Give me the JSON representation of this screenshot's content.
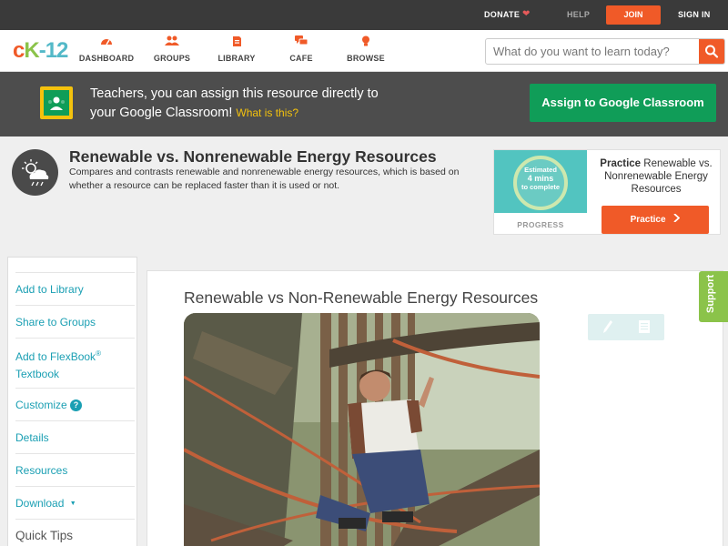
{
  "topbar": {
    "donate": "DONATE",
    "help": "HELP",
    "join": "JOIN",
    "signin": "SIGN IN"
  },
  "logo": {
    "part1": "c",
    "part2": "K",
    "part3": "-12"
  },
  "nav": {
    "items": [
      {
        "label": "DASHBOARD",
        "icon": "dashboard-icon"
      },
      {
        "label": "GROUPS",
        "icon": "groups-icon"
      },
      {
        "label": "LIBRARY",
        "icon": "library-icon"
      },
      {
        "label": "CAFE",
        "icon": "cafe-icon"
      },
      {
        "label": "BROWSE",
        "icon": "browse-icon"
      }
    ],
    "search_placeholder": "What do you want to learn today?"
  },
  "banner": {
    "line1": "Teachers, you can assign this resource directly to",
    "line2": "your Google Classroom!",
    "what": "What is this?",
    "assign": "Assign to Google Classroom"
  },
  "resource": {
    "title": "Renewable vs. Nonrenewable Energy Resources",
    "description": "Compares and contrasts renewable and nonrenewable energy resources, which is based on whether a resource can be replaced faster than it is used or not."
  },
  "practice": {
    "estimated": "Estimated",
    "mins": "4 mins",
    "complete": "to complete",
    "progress_label": "PROGRESS",
    "title_bold": "Practice",
    "title_rest": "Renewable vs. Nonrenewable Energy Resources",
    "button": "Practice"
  },
  "sidebar": {
    "items": [
      "Add to Library",
      "Share to Groups",
      "Add to FlexBook® Textbook",
      "Customize",
      "Details",
      "Resources",
      "Download"
    ],
    "flexbook_line1": "Add to FlexBook",
    "flexbook_sup": "®",
    "flexbook_line2": "Textbook",
    "help_mark": "?",
    "download_caret": "▼",
    "quick_tips": "Quick Tips"
  },
  "main": {
    "title": "Renewable vs Non-Renewable Energy Resources"
  },
  "support": "Support",
  "colors": {
    "accent": "#f05a28",
    "teal": "#1a9fb3",
    "green": "#109d58",
    "lime": "#8bc34a"
  }
}
